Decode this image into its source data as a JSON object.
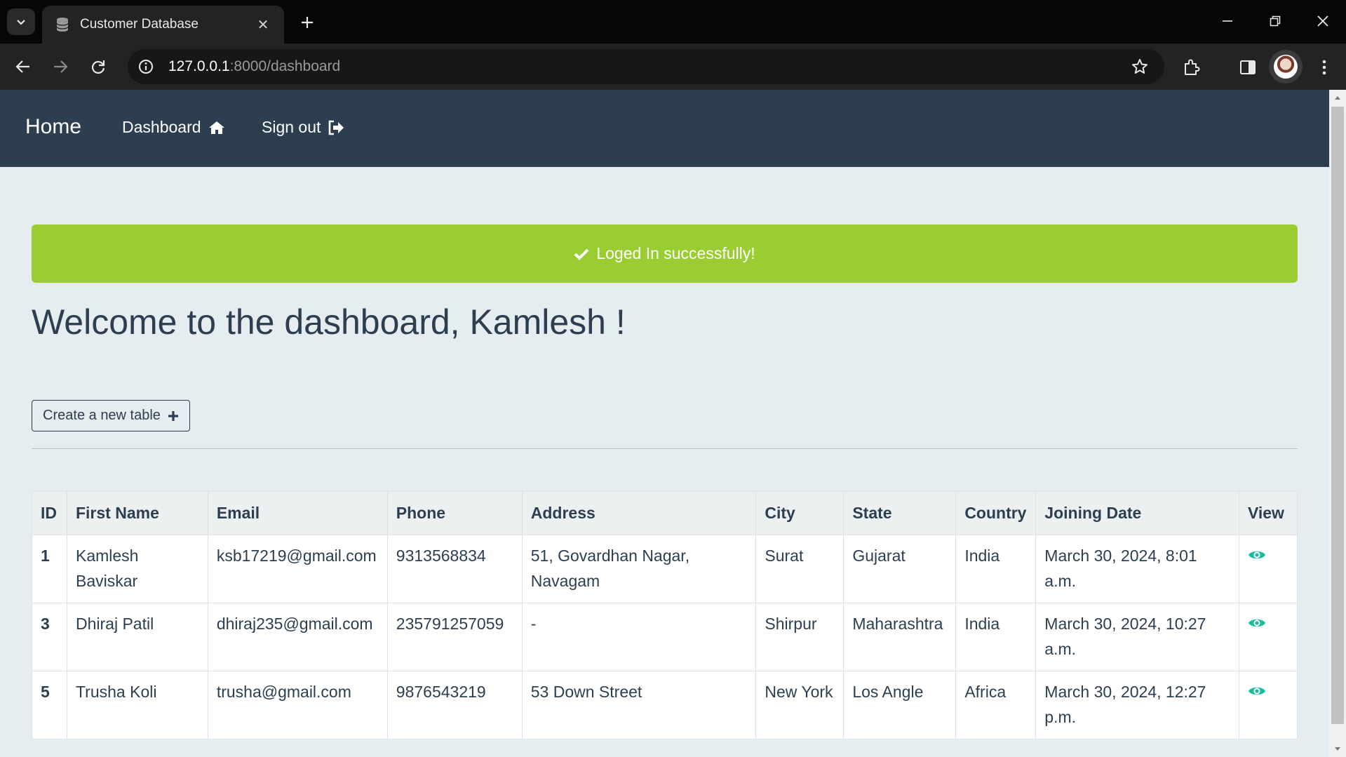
{
  "browser": {
    "tab_title": "Customer Database",
    "url_host": "127.0.0.1",
    "url_path": ":8000/dashboard"
  },
  "navbar": {
    "brand": "Home",
    "dashboard_label": "Dashboard",
    "signout_label": "Sign out"
  },
  "alert": {
    "message": "Loged In successfully!",
    "color": "#9acd32"
  },
  "welcome_text": "Welcome to the dashboard, Kamlesh !",
  "create_button_label": "Create a new table",
  "table": {
    "headers": [
      "ID",
      "First Name",
      "Email",
      "Phone",
      "Address",
      "City",
      "State",
      "Country",
      "Joining Date",
      "View"
    ],
    "rows": [
      {
        "id": "1",
        "first_name": "Kamlesh Baviskar",
        "email": "ksb17219@gmail.com",
        "phone": "9313568834",
        "address": "51, Govardhan Nagar, Navagam",
        "city": "Surat",
        "state": "Gujarat",
        "country": "India",
        "joining_date": "March 30, 2024, 8:01 a.m."
      },
      {
        "id": "3",
        "first_name": "Dhiraj Patil",
        "email": "dhiraj235@gmail.com",
        "phone": "235791257059",
        "address": "-",
        "city": "Shirpur",
        "state": "Maharashtra",
        "country": "India",
        "joining_date": "March 30, 2024, 10:27 a.m."
      },
      {
        "id": "5",
        "first_name": "Trusha Koli",
        "email": "trusha@gmail.com",
        "phone": "9876543219",
        "address": "53 Down Street",
        "city": "New York",
        "state": "Los Angle",
        "country": "Africa",
        "joining_date": "March 30, 2024, 12:27 p.m."
      }
    ]
  },
  "icons": {
    "view": "eye-icon",
    "alert": "check-icon",
    "dashboard": "home-icon",
    "signout": "sign-out-icon",
    "create": "plus-icon"
  },
  "colors": {
    "navbar": "#2c3e50",
    "page_bg": "#e5edf0",
    "eye": "#18bc9c"
  }
}
